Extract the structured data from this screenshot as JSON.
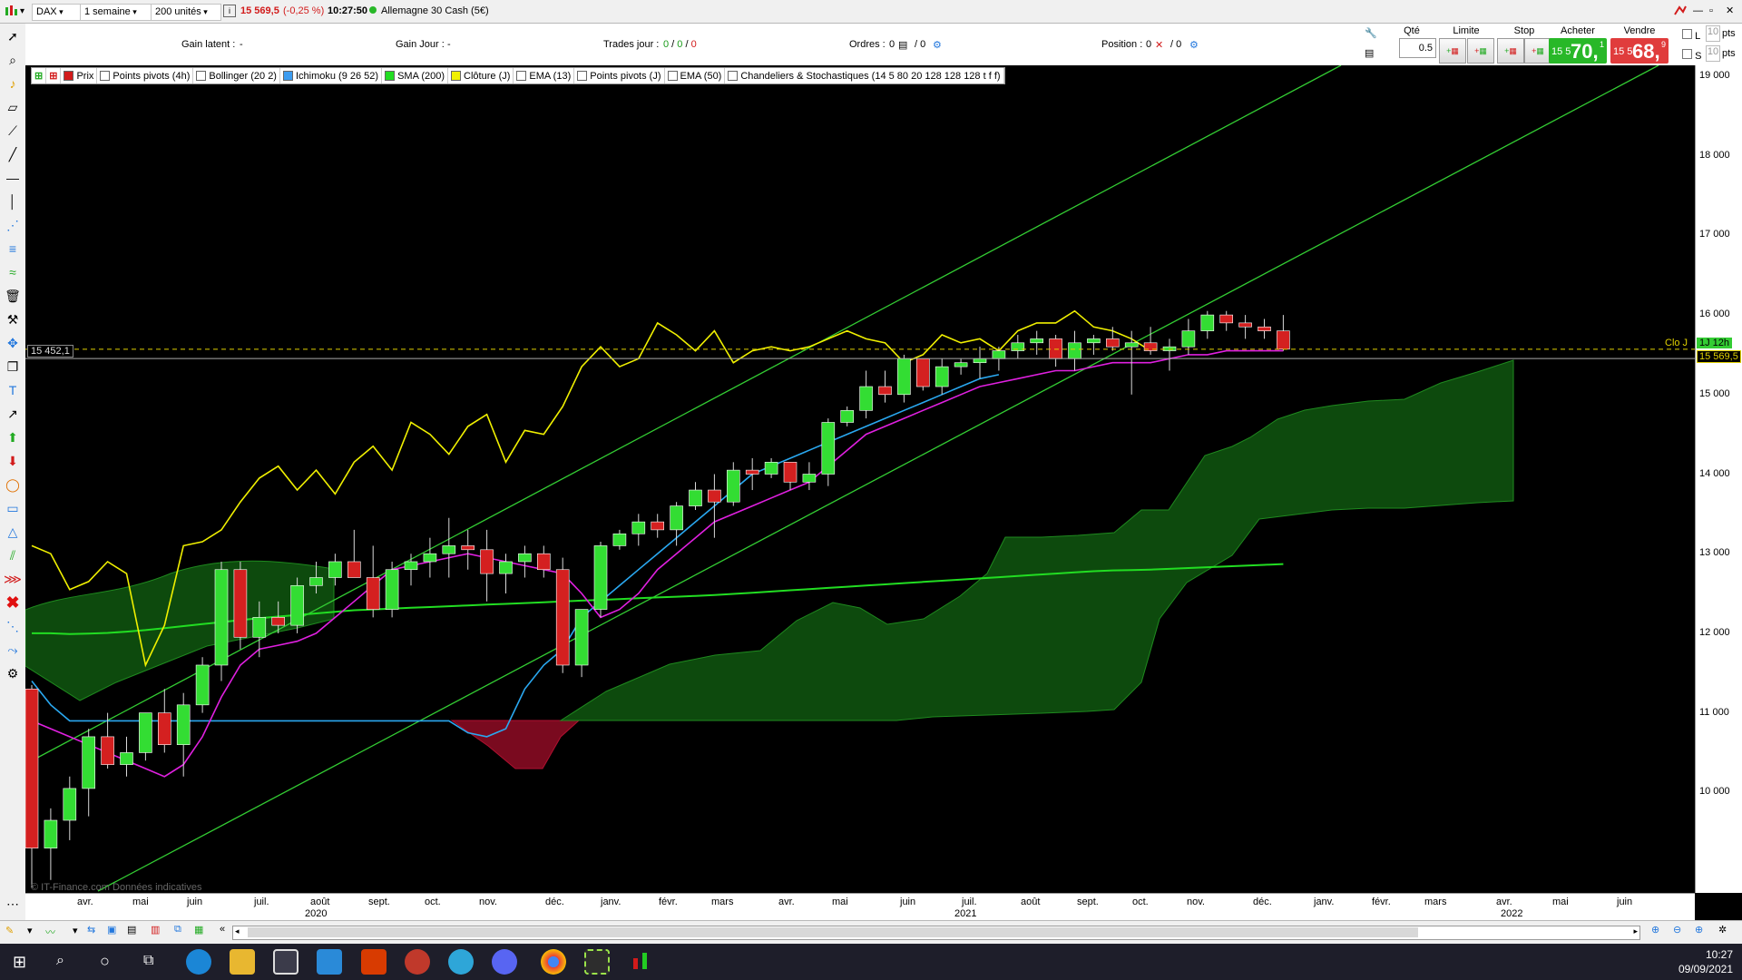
{
  "toolbar": {
    "symbol": "DAX",
    "period": "1 semaine",
    "units": "200 unités",
    "price": "15 569,5",
    "change": "(-0,25 %)",
    "time": "10:27:50",
    "instrument": "Allemagne 30 Cash (5€)"
  },
  "info": {
    "gain_latent_label": "Gain latent :",
    "gain_latent_value": "-",
    "gain_jour_label": "Gain Jour :",
    "gain_jour_value": "-",
    "trades_label": "Trades jour :",
    "trades_a": "0",
    "trades_b": "0",
    "trades_c": "0",
    "ordres_label": "Ordres :",
    "ordres_a": "0",
    "ordres_b": "0",
    "position_label": "Position :",
    "position_a": "0",
    "position_b": "0"
  },
  "order": {
    "qte_label": "Qté",
    "qte_value": "0.5",
    "limite_label": "Limite",
    "stop_label": "Stop",
    "acheter_label": "Acheter",
    "vendre_label": "Vendre",
    "buy_small": "15 5",
    "buy_big": "70,",
    "buy_sup": "1",
    "sell_small": "15 5",
    "sell_big": "68,",
    "sell_sup": "9",
    "l_label": "L",
    "s_label": "S",
    "l_pts": "10",
    "s_pts": "10",
    "pts": "pts"
  },
  "indicators": [
    {
      "label": "Prix",
      "color": "#d21b1b"
    },
    {
      "label": "Points pivots (4h)",
      "color": "#ffffff"
    },
    {
      "label": "Bollinger (20 2)",
      "color": "#ffffff"
    },
    {
      "label": "Ichimoku (9 26 52)",
      "color": "#3c9cf0"
    },
    {
      "label": "SMA (200)",
      "color": "#22dd22"
    },
    {
      "label": "Clôture (J)",
      "color": "#f0f000"
    },
    {
      "label": "EMA (13)",
      "color": "#ffffff"
    },
    {
      "label": "Points pivots (J)",
      "color": "#ffffff"
    },
    {
      "label": "EMA (50)",
      "color": "#ffffff"
    },
    {
      "label": "Chandeliers & Stochastiques (14 5 80 20 128 128 128 t f f)",
      "color": "#ffffff"
    }
  ],
  "chart": {
    "left_price_tag": "15 452,1",
    "clo_label": "Clo J",
    "right_tag_top": "1J 12h",
    "right_tag_price": "15 569,5",
    "watermark": "© IT-Finance.com Données indicatives",
    "y_labels": [
      "19 000",
      "18 000",
      "17 000",
      "16 000",
      "15 000",
      "14 000",
      "13 000",
      "12 000",
      "11 000",
      "10 000"
    ],
    "x_labels": [
      "avr.",
      "mai",
      "juin",
      "juil.",
      "août",
      "sept.",
      "oct.",
      "nov.",
      "déc.",
      "janv.",
      "févr.",
      "mars",
      "avr.",
      "mai",
      "juin",
      "juil.",
      "août",
      "sept.",
      "oct.",
      "nov.",
      "déc.",
      "janv.",
      "févr.",
      "mars",
      "avr.",
      "mai",
      "juin"
    ],
    "x_years": [
      "2020",
      "2021",
      "2022"
    ]
  },
  "chart_data": {
    "type": "candlestick",
    "ylim": [
      9000,
      19000
    ],
    "candles": [
      [
        11300,
        11350,
        8800,
        9300
      ],
      [
        9300,
        9800,
        8900,
        9650
      ],
      [
        9650,
        10200,
        9400,
        10050
      ],
      [
        10050,
        10800,
        9700,
        10700
      ],
      [
        10700,
        11000,
        10300,
        10350
      ],
      [
        10350,
        10700,
        10200,
        10500
      ],
      [
        10500,
        11000,
        10400,
        11000
      ],
      [
        11000,
        11300,
        10500,
        10600
      ],
      [
        10600,
        11250,
        10200,
        11100
      ],
      [
        11100,
        11700,
        11000,
        11600
      ],
      [
        11600,
        12900,
        11400,
        12800
      ],
      [
        12800,
        12900,
        11800,
        11950
      ],
      [
        11950,
        12400,
        11700,
        12200
      ],
      [
        12200,
        12400,
        12000,
        12100
      ],
      [
        12100,
        12700,
        12000,
        12600
      ],
      [
        12600,
        12900,
        12500,
        12700
      ],
      [
        12700,
        13000,
        12600,
        12900
      ],
      [
        12900,
        13300,
        12700,
        12700
      ],
      [
        12700,
        13100,
        12200,
        12300
      ],
      [
        12300,
        12900,
        12200,
        12800
      ],
      [
        12800,
        13000,
        12600,
        12900
      ],
      [
        12900,
        13200,
        12700,
        13000
      ],
      [
        13000,
        13450,
        12700,
        13100
      ],
      [
        13100,
        13300,
        12800,
        13050
      ],
      [
        13050,
        13300,
        12400,
        12750
      ],
      [
        12750,
        13000,
        12500,
        12900
      ],
      [
        12900,
        13100,
        12700,
        13000
      ],
      [
        13000,
        13100,
        12700,
        12800
      ],
      [
        12800,
        12950,
        11500,
        11600
      ],
      [
        11600,
        12300,
        11450,
        12300
      ],
      [
        12300,
        13150,
        12200,
        13100
      ],
      [
        13100,
        13300,
        13050,
        13250
      ],
      [
        13250,
        13500,
        13100,
        13400
      ],
      [
        13400,
        13500,
        13200,
        13300
      ],
      [
        13300,
        13650,
        13100,
        13600
      ],
      [
        13600,
        13900,
        13550,
        13800
      ],
      [
        13800,
        14000,
        13200,
        13650
      ],
      [
        13650,
        14150,
        13600,
        14050
      ],
      [
        14050,
        14200,
        13800,
        14000
      ],
      [
        14000,
        14200,
        13950,
        14150
      ],
      [
        14150,
        14100,
        13800,
        13900
      ],
      [
        13900,
        14150,
        13800,
        14000
      ],
      [
        14000,
        14700,
        13850,
        14650
      ],
      [
        14650,
        14850,
        14600,
        14800
      ],
      [
        14800,
        15300,
        14700,
        15100
      ],
      [
        15100,
        15300,
        14900,
        15000
      ],
      [
        15000,
        15500,
        14900,
        15450
      ],
      [
        15450,
        15300,
        15050,
        15100
      ],
      [
        15100,
        15450,
        15000,
        15350
      ],
      [
        15350,
        15450,
        15250,
        15400
      ],
      [
        15400,
        15600,
        15200,
        15450
      ],
      [
        15450,
        15600,
        15300,
        15550
      ],
      [
        15550,
        15750,
        15450,
        15650
      ],
      [
        15650,
        15800,
        15500,
        15700
      ],
      [
        15700,
        15750,
        15350,
        15450
      ],
      [
        15450,
        15800,
        15300,
        15650
      ],
      [
        15650,
        15750,
        15500,
        15700
      ],
      [
        15700,
        15850,
        15550,
        15600
      ],
      [
        15600,
        15800,
        15000,
        15650
      ],
      [
        15650,
        15850,
        15500,
        15550
      ],
      [
        15550,
        15700,
        15300,
        15600
      ],
      [
        15600,
        15950,
        15500,
        15800
      ],
      [
        15800,
        16050,
        15700,
        16000
      ],
      [
        16000,
        16050,
        15800,
        15900
      ],
      [
        15900,
        16000,
        15700,
        15850
      ],
      [
        15850,
        15950,
        15700,
        15800
      ],
      [
        15800,
        16000,
        15550,
        15570
      ]
    ],
    "close_line": [
      13100,
      13000,
      12550,
      12650,
      12900,
      12750,
      11600,
      12100,
      13100,
      13150,
      13300,
      13650,
      13950,
      14100,
      13800,
      14050,
      13750,
      14150,
      14350,
      14050,
      14650,
      14500,
      14250,
      14600,
      14750,
      14150,
      14550,
      14500,
      14850,
      15350,
      15600,
      15350,
      15450,
      15900,
      15750,
      15550,
      15800,
      15400,
      15550,
      15600,
      15550,
      15600,
      15700,
      15800,
      15700,
      15650,
      15400,
      15500,
      15750,
      15650,
      15700,
      15550,
      15800,
      15900,
      15900,
      16050,
      15850,
      15800,
      15700,
      15550
    ],
    "sma200": [
      12000,
      12000,
      11990,
      11995,
      12005,
      12020,
      12040,
      12065,
      12090,
      12115,
      12140,
      12165,
      12190,
      12210,
      12230,
      12250,
      12270,
      12290,
      12300,
      12310,
      12320,
      12330,
      12340,
      12350,
      12360,
      12370,
      12380,
      12390,
      12400,
      12410,
      12420,
      12430,
      12440,
      12450,
      12460,
      12470,
      12480,
      12495,
      12510,
      12525,
      12540,
      12555,
      12570,
      12585,
      12600,
      12615,
      12630,
      12645,
      12660,
      12675,
      12690,
      12705,
      12720,
      12735,
      12750,
      12765,
      12780,
      12790,
      12795,
      12800,
      12810,
      12820,
      12830,
      12840,
      12850,
      12860,
      12870
    ],
    "tenkan": [
      10900,
      10800,
      10700,
      10600,
      10500,
      10400,
      10300,
      10200,
      10350,
      10700,
      11200,
      11600,
      11800,
      11850,
      11900,
      12000,
      12200,
      12400,
      12600,
      12800,
      12850,
      12900,
      12950,
      13000,
      12950,
      12900,
      12850,
      12800,
      12750,
      12500,
      12200,
      12300,
      12500,
      12800,
      13000,
      13200,
      13400,
      13500,
      13600,
      13700,
      13800,
      13900,
      14100,
      14300,
      14500,
      14600,
      14700,
      14800,
      14900,
      15000,
      15100,
      15150,
      15200,
      15250,
      15300,
      15300,
      15350,
      15400,
      15400,
      15400,
      15450,
      15500,
      15500,
      15550,
      15550,
      15550,
      15550
    ],
    "kijun": [
      11400,
      11100,
      10900,
      10900,
      10900,
      10900,
      10900,
      10900,
      10900,
      10900,
      10900,
      10900,
      10900,
      10900,
      10900,
      10900,
      10900,
      10900,
      10900,
      10900,
      10900,
      10900,
      10900,
      10750,
      10700,
      10800,
      11300,
      11600,
      11800,
      12200,
      12400,
      12600,
      12800,
      13000,
      13200,
      13400,
      13600,
      13800,
      14000,
      14100,
      14200,
      14300,
      14400,
      14500,
      14600,
      14700,
      14800,
      14900,
      15000,
      15100,
      15200,
      15250
    ]
  }
}
